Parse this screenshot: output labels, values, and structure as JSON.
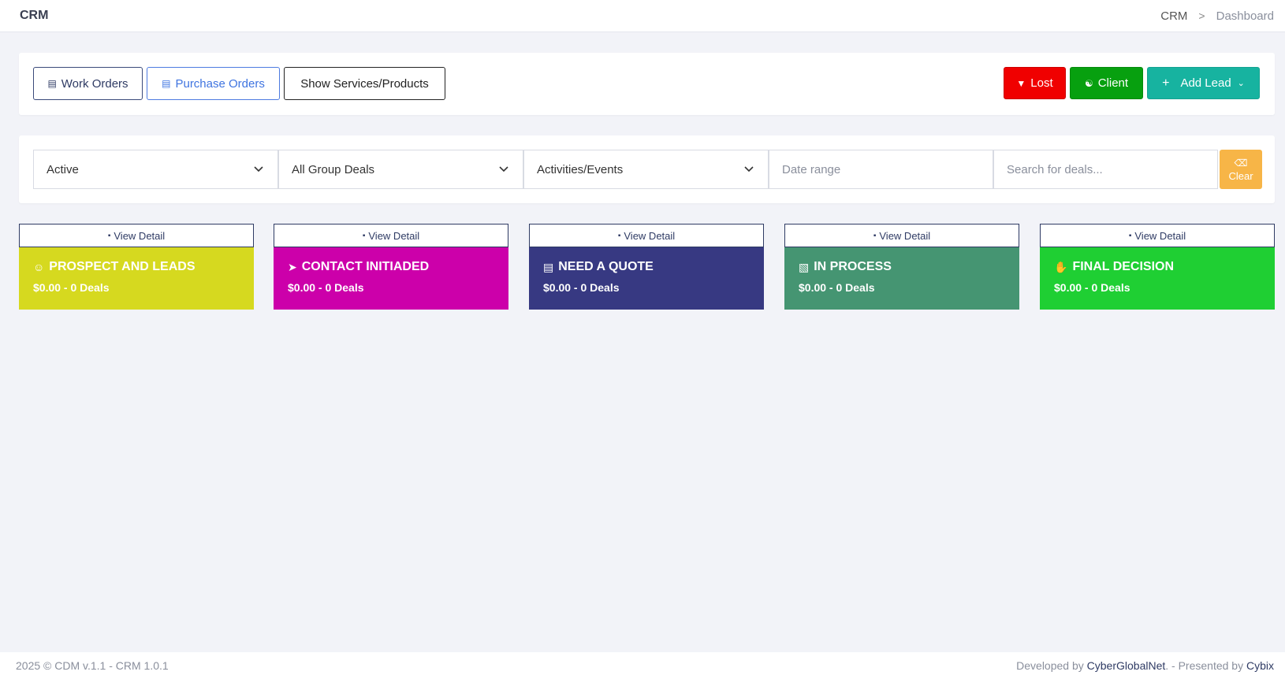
{
  "header": {
    "title": "CRM",
    "breadcrumb": [
      "CRM",
      "Dashboard"
    ],
    "separator": ">"
  },
  "toolbar": {
    "work_orders": "Work Orders",
    "purchase_orders": "Purchase Orders",
    "show_services": "Show Services/Products",
    "lost": "Lost",
    "client": "Client",
    "add_lead": "Add Lead",
    "colors": {
      "lost": "#f00000",
      "client": "#07a00f",
      "add_lead": "#17b3a0"
    }
  },
  "filters": {
    "status": "Active",
    "group": "All Group Deals",
    "activities": "Activities/Events",
    "date_placeholder": "Date range",
    "search_placeholder": "Search for deals...",
    "clear": "Clear",
    "clear_color": "#f7b547"
  },
  "stages": [
    {
      "view": "View Detail",
      "title": "PROSPECT AND LEADS",
      "summary": "$0.00 - 0 Deals",
      "color": "#d6d91f",
      "icon": "smile-icon"
    },
    {
      "view": "View Detail",
      "title": "CONTACT INITIADED",
      "summary": "$0.00 - 0 Deals",
      "color": "#cc00aa",
      "icon": "rocket-icon"
    },
    {
      "view": "View Detail",
      "title": "NEED A QUOTE",
      "summary": "$0.00 - 0 Deals",
      "color": "#373982",
      "icon": "document-icon"
    },
    {
      "view": "View Detail",
      "title": "IN PROCESS",
      "summary": "$0.00 - 0 Deals",
      "color": "#459572",
      "icon": "clipboard-icon"
    },
    {
      "view": "View Detail",
      "title": "FINAL DECISION",
      "summary": "$0.00 - 0 Deals",
      "color": "#1fcf33",
      "icon": "hand-icon"
    }
  ],
  "footer": {
    "left": "2025 © CDM v.1.1 - CRM 1.0.1",
    "dev_prefix": "Developed by",
    "dev_link": "CyberGlobalNet",
    "presented_prefix": ". - Presented by",
    "presented_link": "Cybix"
  }
}
